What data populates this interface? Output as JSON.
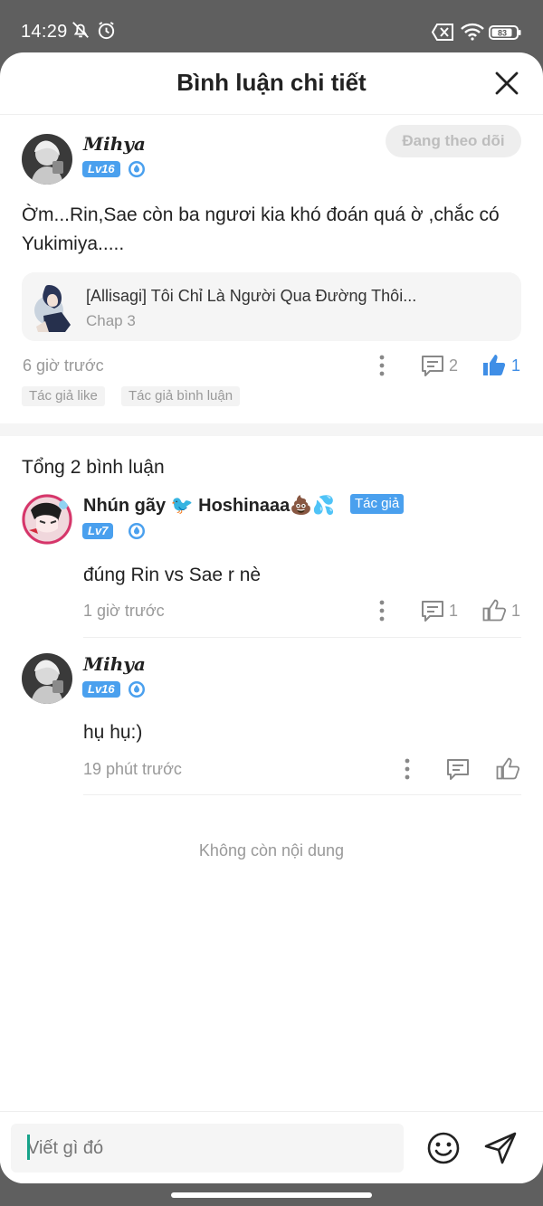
{
  "status_bar": {
    "time": "14:29",
    "battery": "83"
  },
  "header": {
    "title": "Bình luận chi tiết"
  },
  "main_comment": {
    "username": "Mihya",
    "level": "Lv16",
    "follow_label": "Đang theo dõi",
    "text": "Ờm...Rin,Sae còn ba ngươi kia khó đoán quá ờ ,chắc có Yukimiya.....",
    "chapter_card": {
      "title": "[Allisagi] Tôi Chỉ Là Người Qua Đường Thôi...",
      "chapter": "Chap 3"
    },
    "time": "6 giờ trước",
    "reply_count": "2",
    "like_count": "1",
    "tags": [
      "Tác giả like",
      "Tác giả bình luận"
    ]
  },
  "replies_section": {
    "total_label": "Tổng 2 bình luận",
    "replies": [
      {
        "username": "Nhún gãy 🐦 Hoshinaaa💩💦",
        "author_badge": "Tác giả",
        "level": "Lv7",
        "text": "đúng Rin vs Sae r nè",
        "time": "1 giờ trước",
        "reply_count": "1",
        "like_count": "1"
      },
      {
        "username": "Mihya",
        "level": "Lv16",
        "text": "hụ hụ:)",
        "time": "19 phút trước",
        "reply_count": "",
        "like_count": ""
      }
    ],
    "end_note": "Không còn nội dung"
  },
  "composer": {
    "placeholder": "Viết gì đó"
  },
  "colors": {
    "accent": "#4aa0ee",
    "like_active": "#3f8ee6",
    "muted": "#999999"
  }
}
